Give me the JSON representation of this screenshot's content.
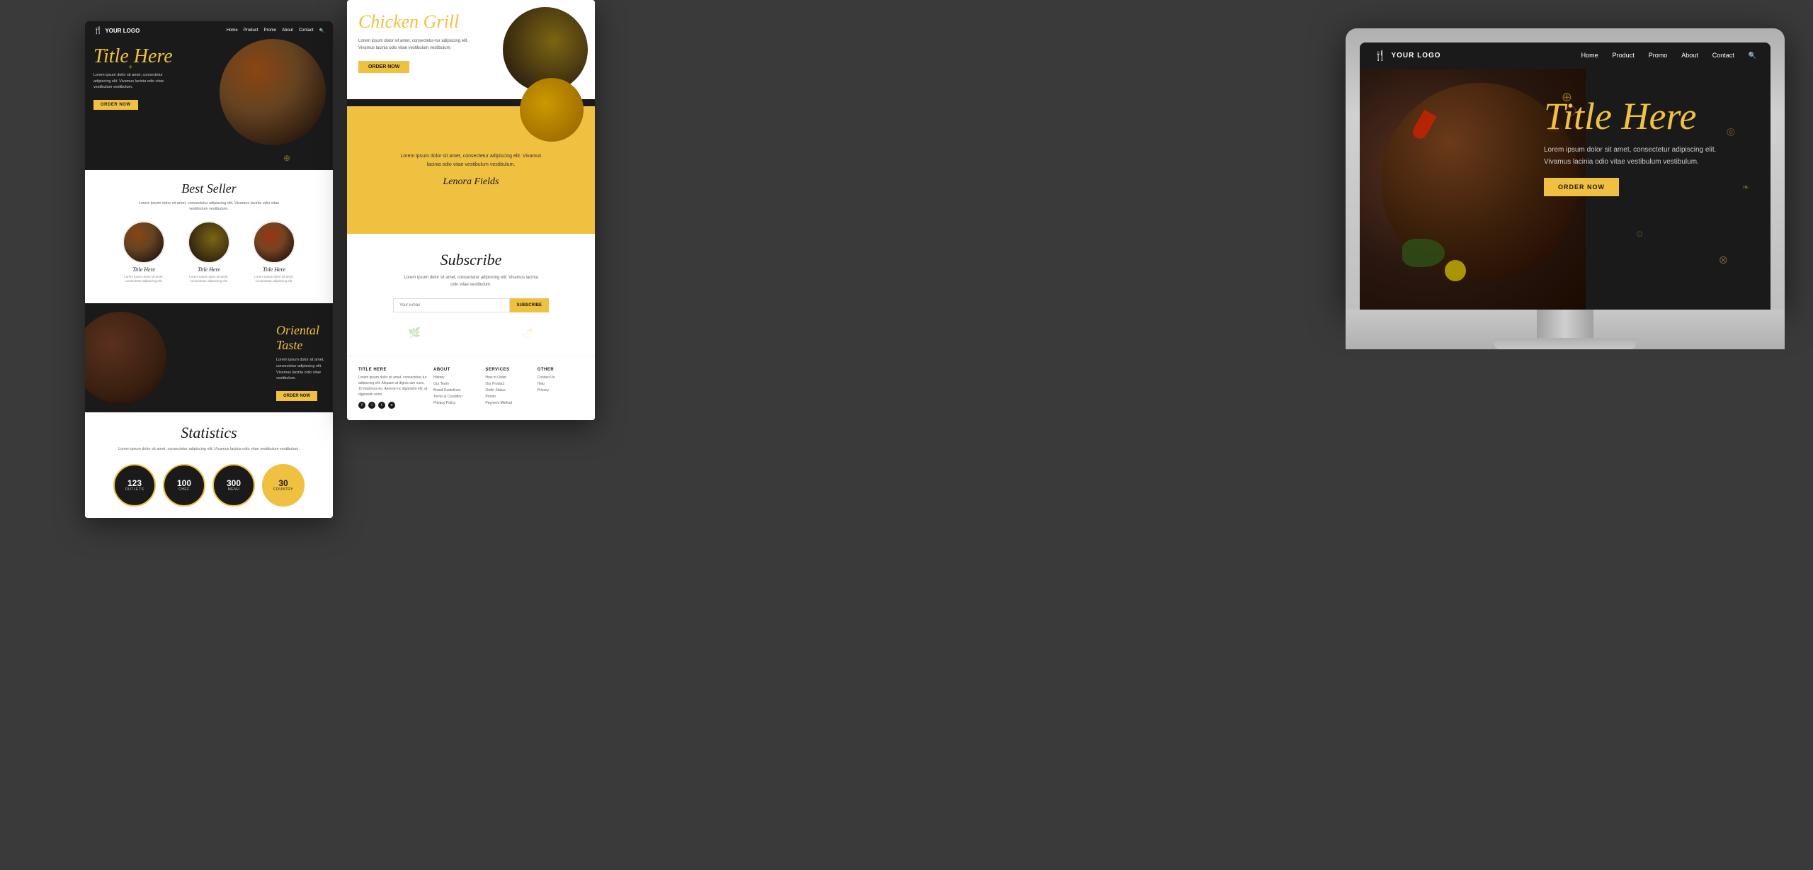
{
  "background": {
    "color": "#3a3a3a"
  },
  "mockup_left": {
    "nav": {
      "logo": "YOUR LOGO",
      "links": [
        "Home",
        "Product",
        "Promo",
        "About",
        "Contact"
      ]
    },
    "hero": {
      "title": "Title Here",
      "description": "Lorem ipsum dolor sit amet, consectetur adipiscing elit. Vivamus lacinia odio vitae vestibulum vestibulum.",
      "button": "ORDER NOW"
    },
    "bestseller": {
      "title": "Best Seller",
      "description": "Lorem ipsum dolor sit amet, consectetur adipiscing elit. Vivamus lacinia odio vitae vestibulum vestibulum.",
      "products": [
        {
          "title": "Title Here",
          "desc": "Lorem ipsum dolor sit amet, consectetur adipiscing elit."
        },
        {
          "title": "Title Here",
          "desc": "Lorem ipsum dolor sit amet, consectetur adipiscing elit."
        },
        {
          "title": "Title Here",
          "desc": "Lorem ipsum dolor sit amet, consectetur adipiscing elit."
        }
      ]
    },
    "oriental": {
      "title": "Oriental Taste",
      "description": "Lorem ipsum dolor sit amet, consectetur adipiscing elit. Vivamus lacinia odio vitae vestibulum.",
      "button": "ORDER NOW"
    },
    "statistics": {
      "title": "Statistics",
      "description": "Lorem ipsum dolor sit amet, consectetur adipiscing elit. Vivamus lacinia odio vitae vestibulum vestibulum.",
      "stats": [
        {
          "number": "123",
          "label": "OUTLETS"
        },
        {
          "number": "100",
          "label": "CHEF"
        },
        {
          "number": "300",
          "label": "MENU"
        },
        {
          "number": "30",
          "label": "COUNTRY"
        }
      ]
    }
  },
  "mockup_middle": {
    "hero": {
      "title": "Chicken Grill",
      "description": "Lorem ipsum dolor sit amet, consectetur-tur adipiscing elit. Vivamus lacinia odio vitae vestibulum vestibulum.",
      "button": "ORDER NOW"
    },
    "testimonial": {
      "text": "Lorem ipsum dolor sit amet, consectetur adipiscing elit. Vivamus lacinia odio vitae vestibulum vestibulum.",
      "author": "Lenora Fields"
    },
    "subscribe": {
      "title": "Subscribe",
      "description": "Lorem ipsum dolor sit amet, consectetur adipiscing elit. Vivamus lacinia odio vitae vestibulum.",
      "placeholder": "Your Email",
      "button": "SUBSCRIBE"
    },
    "footer": {
      "columns": [
        {
          "title": "TITLE HERE",
          "text": "Lorem ipsum dolor sit amet, consectetur-tur adipiscing elit. Aliquam at dignis-sim nunc, 10 maximus eu. Aenean nc dignissim elit, at dignissim enim."
        },
        {
          "title": "ABOUT",
          "links": [
            "History",
            "Our Team",
            "Brand Guidelines",
            "Terms & Condition",
            "Privacy Policy"
          ]
        },
        {
          "title": "SERVICES",
          "links": [
            "How to Order",
            "Our Product",
            "Order Status",
            "Promo",
            "Payment Method"
          ]
        },
        {
          "title": "OTHER",
          "links": [
            "Contact Us",
            "Help",
            "Privacy"
          ]
        }
      ],
      "social_icons": [
        "f",
        "i",
        "t",
        "o"
      ]
    }
  },
  "mockup_right": {
    "nav": {
      "logo": "YOUR LOGO",
      "links": [
        "Home",
        "Product",
        "Promo",
        "About",
        "Contact"
      ]
    },
    "hero": {
      "title": "Title Here",
      "description": "Lorem ipsum dolor sit amet, consectetur adipiscing elit. Vivamus lacinia odio vitae vestibulum vestibulum.",
      "button": "ORDER NOW"
    }
  }
}
